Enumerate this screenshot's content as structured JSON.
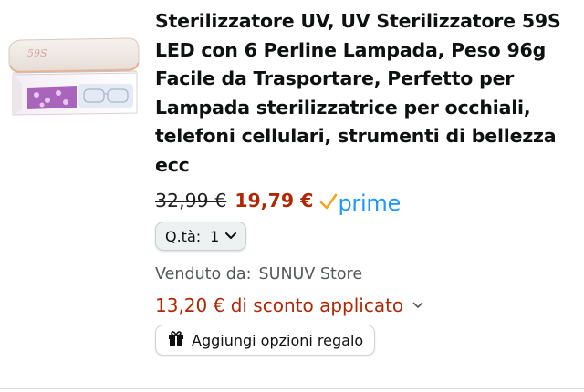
{
  "product": {
    "title": "Sterilizzatore UV, UV Sterilizzatore 59S LED con 6 Perline Lampada, Peso 96g Facile da Trasportare, Perfetto per Lampada sterilizzatrice per occhiali, telefoni cellulari, strumenti di bellezza ecc",
    "image_label": "59S",
    "old_price": "32,99 €",
    "price": "19,79 €",
    "prime_label": "prime",
    "quantity_label": "Q.tà:",
    "quantity_value": "1",
    "seller_label": "Venduto da:",
    "seller_name": "SUNUV Store",
    "discount_text": "13,20 € di sconto applicato",
    "gift_button_label": "Aggiungi opzioni regalo"
  },
  "colors": {
    "price": "#b12704",
    "prime_blue": "#1a98ff",
    "prime_check": "#f4a51c",
    "muted_text": "#565959"
  },
  "icons": {
    "prime": "prime-check-icon",
    "quantity": "chevron-down-icon",
    "discount": "chevron-down-icon",
    "gift": "gift-icon"
  }
}
